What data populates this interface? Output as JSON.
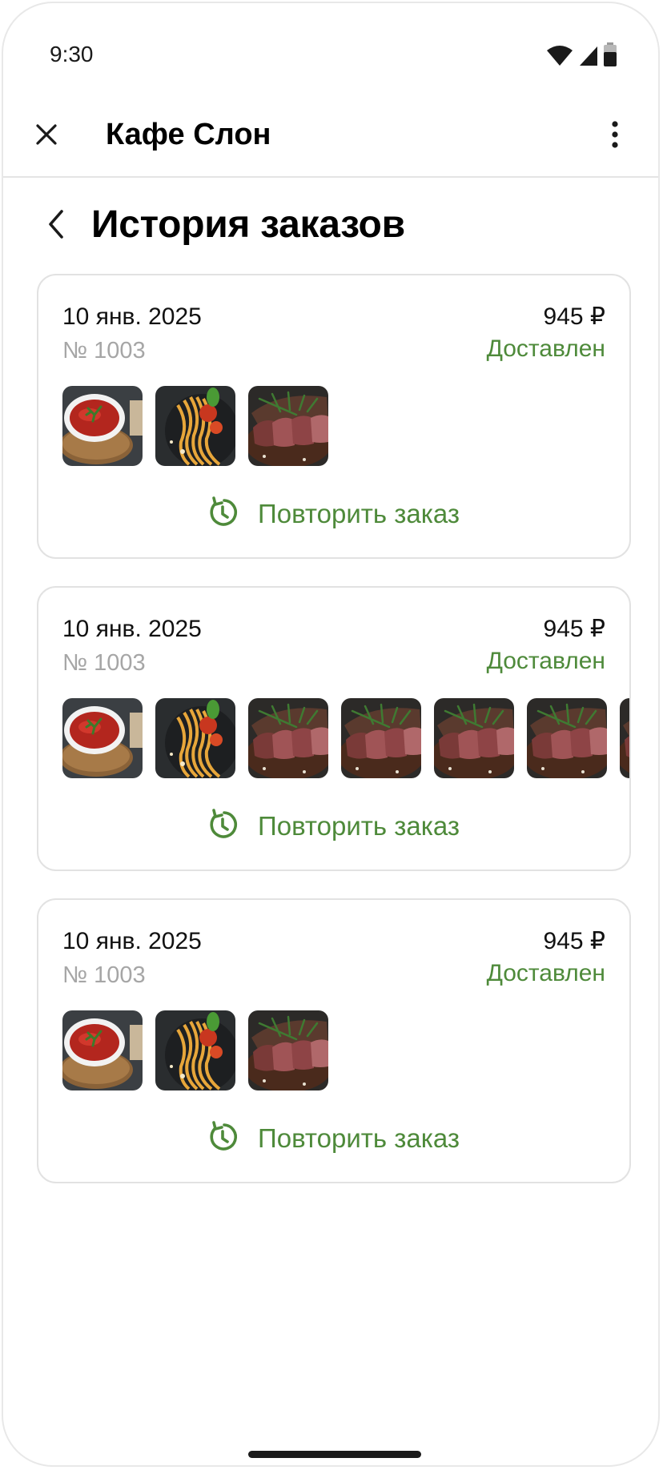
{
  "status_bar": {
    "time": "9:30",
    "icons": [
      "wifi-icon",
      "cellular-signal-icon",
      "battery-icon"
    ]
  },
  "app_bar": {
    "title": "Кафе Слон",
    "close_icon": "close-icon",
    "more_icon": "more-vertical-icon"
  },
  "page": {
    "title": "История заказов",
    "back_icon": "chevron-left-icon"
  },
  "colors": {
    "accent": "#4e8a3a",
    "muted_text": "#a6a6a6",
    "card_border": "#e2e2e2"
  },
  "orders": [
    {
      "date": "10 янв. 2025",
      "number": "№ 1003",
      "price": "945 ₽",
      "status": "Доставлен",
      "items": [
        "borscht-photo",
        "spaghetti-photo",
        "steak-photo"
      ],
      "repeat_label": "Повторить заказ"
    },
    {
      "date": "10 янв. 2025",
      "number": "№ 1003",
      "price": "945 ₽",
      "status": "Доставлен",
      "items": [
        "borscht-photo",
        "spaghetti-photo",
        "steak-photo",
        "steak-photo",
        "steak-photo",
        "steak-photo",
        "steak-photo"
      ],
      "repeat_label": "Повторить заказ"
    },
    {
      "date": "10 янв. 2025",
      "number": "№ 1003",
      "price": "945 ₽",
      "status": "Доставлен",
      "items": [
        "borscht-photo",
        "spaghetti-photo",
        "steak-photo"
      ],
      "repeat_label": "Повторить заказ"
    }
  ]
}
